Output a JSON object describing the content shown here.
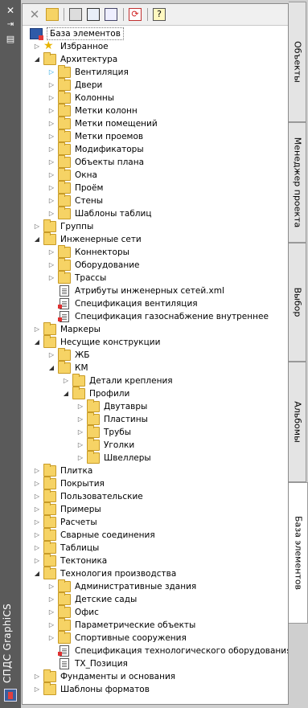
{
  "app_title": "СПДС GraphiCS",
  "tabs": [
    {
      "label": "Объекты",
      "active": false
    },
    {
      "label": "Менеджер проекта",
      "active": false
    },
    {
      "label": "Выбор",
      "active": false
    },
    {
      "label": "Альбомы",
      "active": false
    },
    {
      "label": "База элементов",
      "active": true
    }
  ],
  "toolbar_icons": [
    "delete-icon",
    "open-folder-icon",
    "copy-icon",
    "replace-icon",
    "find-icon",
    "refresh-icon",
    "help-icon"
  ],
  "colors": {
    "folder": "#f6d365",
    "strip": "#5a5a5a",
    "selected_arrow": "#1ba1e2"
  },
  "tree": [
    {
      "label": "База элементов",
      "type": "root",
      "level": 0,
      "state": "none"
    },
    {
      "label": "Избранное",
      "type": "star",
      "level": 1,
      "state": "closed"
    },
    {
      "label": "Архитектура",
      "type": "folder",
      "level": 1,
      "state": "open"
    },
    {
      "label": "Вентиляция",
      "type": "folder",
      "level": 2,
      "state": "hover"
    },
    {
      "label": "Двери",
      "type": "folder",
      "level": 2,
      "state": "closed"
    },
    {
      "label": "Колонны",
      "type": "folder",
      "level": 2,
      "state": "closed"
    },
    {
      "label": "Метки колонн",
      "type": "folder",
      "level": 2,
      "state": "closed"
    },
    {
      "label": "Метки помещений",
      "type": "folder",
      "level": 2,
      "state": "closed"
    },
    {
      "label": "Метки проемов",
      "type": "folder",
      "level": 2,
      "state": "closed"
    },
    {
      "label": "Модификаторы",
      "type": "folder",
      "level": 2,
      "state": "closed"
    },
    {
      "label": "Объекты плана",
      "type": "folder",
      "level": 2,
      "state": "closed"
    },
    {
      "label": "Окна",
      "type": "folder",
      "level": 2,
      "state": "closed"
    },
    {
      "label": "Проём",
      "type": "folder",
      "level": 2,
      "state": "closed"
    },
    {
      "label": "Стены",
      "type": "folder",
      "level": 2,
      "state": "closed"
    },
    {
      "label": "Шаблоны таблиц",
      "type": "folder",
      "level": 2,
      "state": "closed"
    },
    {
      "label": "Группы",
      "type": "folder",
      "level": 1,
      "state": "closed"
    },
    {
      "label": "Инженерные сети",
      "type": "folder",
      "level": 1,
      "state": "open"
    },
    {
      "label": "Коннекторы",
      "type": "folder",
      "level": 2,
      "state": "closed"
    },
    {
      "label": "Оборудование",
      "type": "folder",
      "level": 2,
      "state": "closed"
    },
    {
      "label": "Трассы",
      "type": "folder",
      "level": 2,
      "state": "closed"
    },
    {
      "label": "Атрибуты инженерных сетей.xml",
      "type": "doc",
      "level": 2,
      "state": "none"
    },
    {
      "label": "Спецификация вентиляция",
      "type": "doc-red",
      "level": 2,
      "state": "none"
    },
    {
      "label": "Спецификация газоснабжение внутреннее",
      "type": "doc-red",
      "level": 2,
      "state": "none"
    },
    {
      "label": "Маркеры",
      "type": "folder",
      "level": 1,
      "state": "closed"
    },
    {
      "label": "Несущие конструкции",
      "type": "folder",
      "level": 1,
      "state": "open"
    },
    {
      "label": "ЖБ",
      "type": "folder",
      "level": 2,
      "state": "closed"
    },
    {
      "label": "КМ",
      "type": "folder",
      "level": 2,
      "state": "open"
    },
    {
      "label": "Детали крепления",
      "type": "folder",
      "level": 3,
      "state": "closed"
    },
    {
      "label": "Профили",
      "type": "folder",
      "level": 3,
      "state": "open"
    },
    {
      "label": "Двутавры",
      "type": "folder",
      "level": 4,
      "state": "closed"
    },
    {
      "label": "Пластины",
      "type": "folder",
      "level": 4,
      "state": "closed"
    },
    {
      "label": "Трубы",
      "type": "folder",
      "level": 4,
      "state": "closed"
    },
    {
      "label": "Уголки",
      "type": "folder",
      "level": 4,
      "state": "closed"
    },
    {
      "label": "Швеллеры",
      "type": "folder",
      "level": 4,
      "state": "closed"
    },
    {
      "label": "Плитка",
      "type": "folder",
      "level": 1,
      "state": "closed"
    },
    {
      "label": "Покрытия",
      "type": "folder",
      "level": 1,
      "state": "closed"
    },
    {
      "label": "Пользовательские",
      "type": "folder",
      "level": 1,
      "state": "closed"
    },
    {
      "label": "Примеры",
      "type": "folder",
      "level": 1,
      "state": "closed"
    },
    {
      "label": "Расчеты",
      "type": "folder",
      "level": 1,
      "state": "closed"
    },
    {
      "label": "Сварные соединения",
      "type": "folder",
      "level": 1,
      "state": "closed"
    },
    {
      "label": "Таблицы",
      "type": "folder",
      "level": 1,
      "state": "closed"
    },
    {
      "label": "Тектоника",
      "type": "folder",
      "level": 1,
      "state": "closed"
    },
    {
      "label": "Технология производства",
      "type": "folder",
      "level": 1,
      "state": "open"
    },
    {
      "label": "Административные здания",
      "type": "folder",
      "level": 2,
      "state": "closed"
    },
    {
      "label": "Детские сады",
      "type": "folder",
      "level": 2,
      "state": "closed"
    },
    {
      "label": "Офис",
      "type": "folder",
      "level": 2,
      "state": "closed"
    },
    {
      "label": "Параметрические объекты",
      "type": "folder",
      "level": 2,
      "state": "closed"
    },
    {
      "label": "Спортивные сооружения",
      "type": "folder",
      "level": 2,
      "state": "closed"
    },
    {
      "label": "Спецификация технологического оборудования",
      "type": "doc-red",
      "level": 2,
      "state": "none"
    },
    {
      "label": "ТХ_Позиция",
      "type": "doc",
      "level": 2,
      "state": "none"
    },
    {
      "label": "Фундаменты и основания",
      "type": "folder",
      "level": 1,
      "state": "closed"
    },
    {
      "label": "Шаблоны форматов",
      "type": "folder",
      "level": 1,
      "state": "closed"
    }
  ]
}
